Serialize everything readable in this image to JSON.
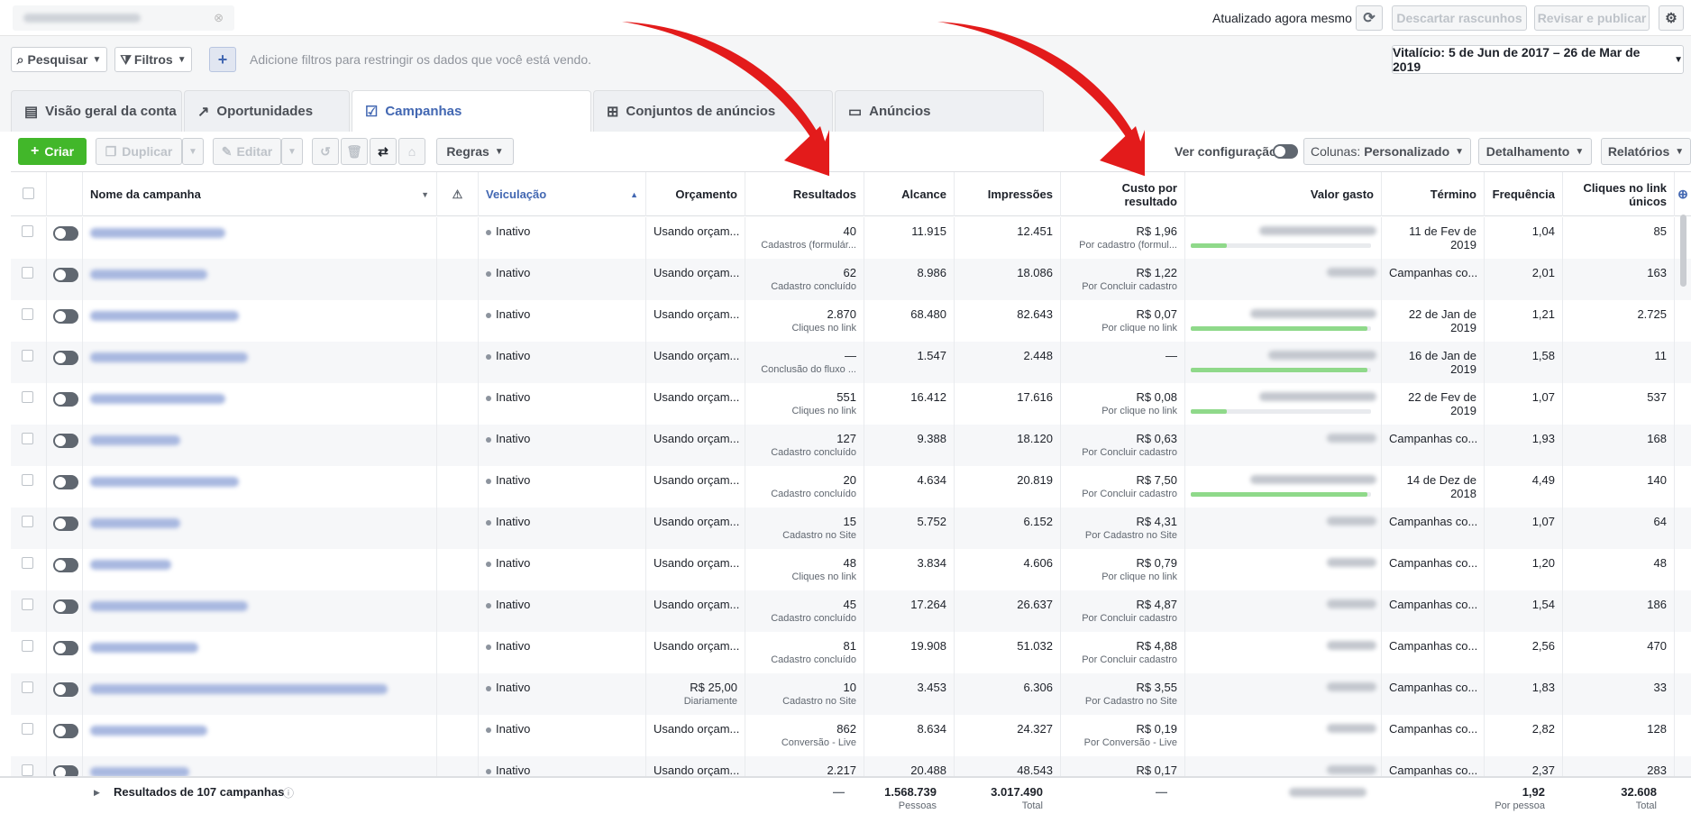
{
  "top": {
    "updated": "Atualizado agora mesmo",
    "discard": "Descartar rascunhos",
    "review": "Revisar e publicar"
  },
  "filters": {
    "search": "Pesquisar",
    "filters": "Filtros",
    "hint": "Adicione filtros para restringir os dados que você está vendo.",
    "date_range": "Vitalício: 5 de Jun de 2017 – 26 de Mar de 2019"
  },
  "tabs": [
    {
      "label": "Visão geral da conta",
      "icon": "account-overview-icon"
    },
    {
      "label": "Oportunidades",
      "icon": "trend-icon"
    },
    {
      "label": "Campanhas",
      "icon": "campaign-folder-icon"
    },
    {
      "label": "Conjuntos de anúncios",
      "icon": "grid-icon"
    },
    {
      "label": "Anúncios",
      "icon": "ad-monitor-icon"
    }
  ],
  "toolbar": {
    "create": "Criar",
    "duplicate": "Duplicar",
    "edit": "Editar",
    "rules": "Regras",
    "view_settings": "Ver configuração",
    "columns_label": "Colunas:",
    "columns_value": "Personalizado",
    "breakdown": "Detalhamento",
    "reports": "Relatórios"
  },
  "columns": {
    "name": "Nome da campanha",
    "delivery": "Veiculação",
    "budget": "Orçamento",
    "results": "Resultados",
    "reach": "Alcance",
    "impressions": "Impressões",
    "cpr": "Custo por resultado",
    "spent": "Valor gasto",
    "end": "Término",
    "frequency": "Frequência",
    "unique_clicks": "Cliques no link únicos"
  },
  "rows": [
    {
      "status": "Inativo",
      "budget": "Usando orçam...",
      "budget_sub": "",
      "results": "40",
      "results_sub": "Cadastros (formulár...",
      "reach": "11.915",
      "impressions": "12.451",
      "cpr": "R$ 1,96",
      "cpr_sub": "Por cadastro (formul...",
      "spent_pct": 0.2,
      "end": "11 de Fev de",
      "end2": "2019",
      "frequency": "1,04",
      "clicks": "85"
    },
    {
      "status": "Inativo",
      "budget": "Usando orçam...",
      "budget_sub": "",
      "results": "62",
      "results_sub": "Cadastro concluído",
      "reach": "8.986",
      "impressions": "18.086",
      "cpr": "R$ 1,22",
      "cpr_sub": "Por Concluir cadastro",
      "spent_pct": 0,
      "end": "Campanhas co...",
      "end2": "",
      "frequency": "2,01",
      "clicks": "163"
    },
    {
      "status": "Inativo",
      "budget": "Usando orçam...",
      "budget_sub": "",
      "results": "2.870",
      "results_sub": "Cliques no link",
      "reach": "68.480",
      "impressions": "82.643",
      "cpr": "R$ 0,07",
      "cpr_sub": "Por clique no link",
      "spent_pct": 0.98,
      "end": "22 de Jan de",
      "end2": "2019",
      "frequency": "1,21",
      "clicks": "2.725"
    },
    {
      "status": "Inativo",
      "budget": "Usando orçam...",
      "budget_sub": "",
      "results": "—",
      "results_sub": "Conclusão do fluxo ...",
      "reach": "1.547",
      "impressions": "2.448",
      "cpr": "—",
      "cpr_sub": "",
      "spent_pct": 0.98,
      "end": "16 de Jan de",
      "end2": "2019",
      "frequency": "1,58",
      "clicks": "11"
    },
    {
      "status": "Inativo",
      "budget": "Usando orçam...",
      "budget_sub": "",
      "results": "551",
      "results_sub": "Cliques no link",
      "reach": "16.412",
      "impressions": "17.616",
      "cpr": "R$ 0,08",
      "cpr_sub": "Por clique no link",
      "spent_pct": 0.2,
      "end": "22 de Fev de",
      "end2": "2019",
      "frequency": "1,07",
      "clicks": "537"
    },
    {
      "status": "Inativo",
      "budget": "Usando orçam...",
      "budget_sub": "",
      "results": "127",
      "results_sub": "Cadastro concluído",
      "reach": "9.388",
      "impressions": "18.120",
      "cpr": "R$ 0,63",
      "cpr_sub": "Por Concluir cadastro",
      "spent_pct": 0,
      "end": "Campanhas co...",
      "end2": "",
      "frequency": "1,93",
      "clicks": "168"
    },
    {
      "status": "Inativo",
      "budget": "Usando orçam...",
      "budget_sub": "",
      "results": "20",
      "results_sub": "Cadastro concluído",
      "reach": "4.634",
      "impressions": "20.819",
      "cpr": "R$ 7,50",
      "cpr_sub": "Por Concluir cadastro",
      "spent_pct": 0.98,
      "end": "14 de Dez de",
      "end2": "2018",
      "frequency": "4,49",
      "clicks": "140"
    },
    {
      "status": "Inativo",
      "budget": "Usando orçam...",
      "budget_sub": "",
      "results": "15",
      "results_sub": "Cadastro no Site",
      "reach": "5.752",
      "impressions": "6.152",
      "cpr": "R$ 4,31",
      "cpr_sub": "Por Cadastro no Site",
      "spent_pct": 0,
      "end": "Campanhas co...",
      "end2": "",
      "frequency": "1,07",
      "clicks": "64"
    },
    {
      "status": "Inativo",
      "budget": "Usando orçam...",
      "budget_sub": "",
      "results": "48",
      "results_sub": "Cliques no link",
      "reach": "3.834",
      "impressions": "4.606",
      "cpr": "R$ 0,79",
      "cpr_sub": "Por clique no link",
      "spent_pct": 0,
      "end": "Campanhas co...",
      "end2": "",
      "frequency": "1,20",
      "clicks": "48"
    },
    {
      "status": "Inativo",
      "budget": "Usando orçam...",
      "budget_sub": "",
      "results": "45",
      "results_sub": "Cadastro concluído",
      "reach": "17.264",
      "impressions": "26.637",
      "cpr": "R$ 4,87",
      "cpr_sub": "Por Concluir cadastro",
      "spent_pct": 0,
      "end": "Campanhas co...",
      "end2": "",
      "frequency": "1,54",
      "clicks": "186"
    },
    {
      "status": "Inativo",
      "budget": "Usando orçam...",
      "budget_sub": "",
      "results": "81",
      "results_sub": "Cadastro concluído",
      "reach": "19.908",
      "impressions": "51.032",
      "cpr": "R$ 4,88",
      "cpr_sub": "Por Concluir cadastro",
      "spent_pct": 0,
      "end": "Campanhas co...",
      "end2": "",
      "frequency": "2,56",
      "clicks": "470"
    },
    {
      "status": "Inativo",
      "budget": "R$ 25,00",
      "budget_sub": "Diariamente",
      "results": "10",
      "results_sub": "Cadastro no Site",
      "reach": "3.453",
      "impressions": "6.306",
      "cpr": "R$ 3,55",
      "cpr_sub": "Por Cadastro no Site",
      "spent_pct": 0,
      "end": "Campanhas co...",
      "end2": "",
      "frequency": "1,83",
      "clicks": "33"
    },
    {
      "status": "Inativo",
      "budget": "Usando orçam...",
      "budget_sub": "",
      "results": "862",
      "results_sub": "Conversão - Live",
      "reach": "8.634",
      "impressions": "24.327",
      "cpr": "R$ 0,19",
      "cpr_sub": "Por Conversão - Live",
      "spent_pct": 0,
      "end": "Campanhas co...",
      "end2": "",
      "frequency": "2,82",
      "clicks": "128"
    },
    {
      "status": "Inativo",
      "budget": "Usando orçam...",
      "budget_sub": "",
      "results": "2.217",
      "results_sub": "",
      "reach": "20.488",
      "impressions": "48.543",
      "cpr": "R$ 0,17",
      "cpr_sub": "",
      "spent_pct": 0,
      "end": "Campanhas co...",
      "end2": "",
      "frequency": "2,37",
      "clicks": "283"
    }
  ],
  "footer": {
    "label": "Resultados de 107 campanhas",
    "results": "—",
    "reach": "1.568.739",
    "reach_sub": "Pessoas",
    "impressions": "3.017.490",
    "impressions_sub": "Total",
    "cpr": "—",
    "frequency": "1,92",
    "frequency_sub": "Por pessoa",
    "clicks": "32.608",
    "clicks_sub": "Total"
  }
}
